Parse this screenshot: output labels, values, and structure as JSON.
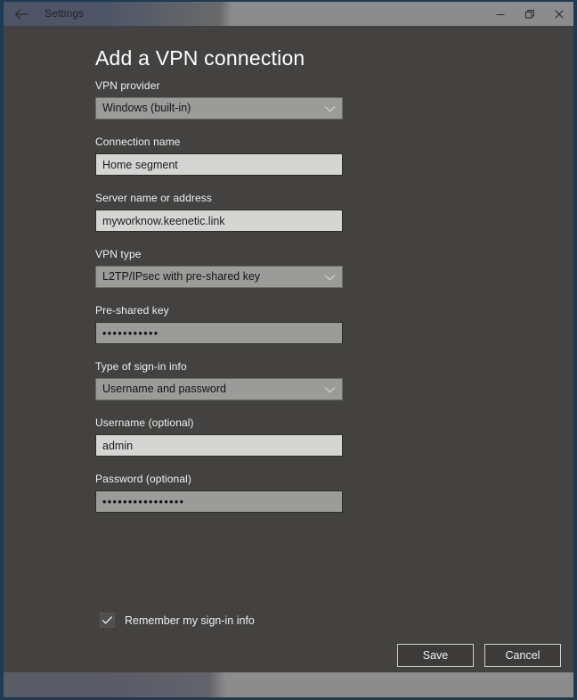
{
  "window": {
    "title": "Settings",
    "back_icon": "back-arrow-icon",
    "controls": {
      "minimize": "minimize-icon",
      "maximize": "restore-icon",
      "close": "close-icon"
    }
  },
  "page": {
    "title": "Add a VPN connection"
  },
  "form": {
    "vpn_provider": {
      "label": "VPN provider",
      "value": "Windows (built-in)",
      "type": "dropdown"
    },
    "connection_name": {
      "label": "Connection name",
      "value": "Home segment",
      "placeholder": "",
      "type": "text"
    },
    "server_name": {
      "label": "Server name or address",
      "value": "myworknow.keenetic.link",
      "placeholder": "",
      "type": "text"
    },
    "vpn_type": {
      "label": "VPN type",
      "value": "L2TP/IPsec with pre-shared key",
      "type": "dropdown"
    },
    "preshared_key": {
      "label": "Pre-shared key",
      "value": "•••••••••••",
      "placeholder": "",
      "type": "password"
    },
    "signin_type": {
      "label": "Type of sign-in info",
      "value": "Username and password",
      "type": "dropdown"
    },
    "username": {
      "label": "Username (optional)",
      "value": "admin",
      "placeholder": "",
      "type": "text"
    },
    "password": {
      "label": "Password (optional)",
      "value": "••••••••••••••••",
      "placeholder": "",
      "type": "password"
    },
    "remember": {
      "label": "Remember my sign-in info",
      "checked": true
    }
  },
  "actions": {
    "save_label": "Save",
    "cancel_label": "Cancel"
  },
  "colors": {
    "page_background": "#434240",
    "textbox_background": "#d5d5d3",
    "combo_background": "#9b9b99",
    "window_border": "#1d3b52",
    "text_primary": "#f0f0f0"
  }
}
